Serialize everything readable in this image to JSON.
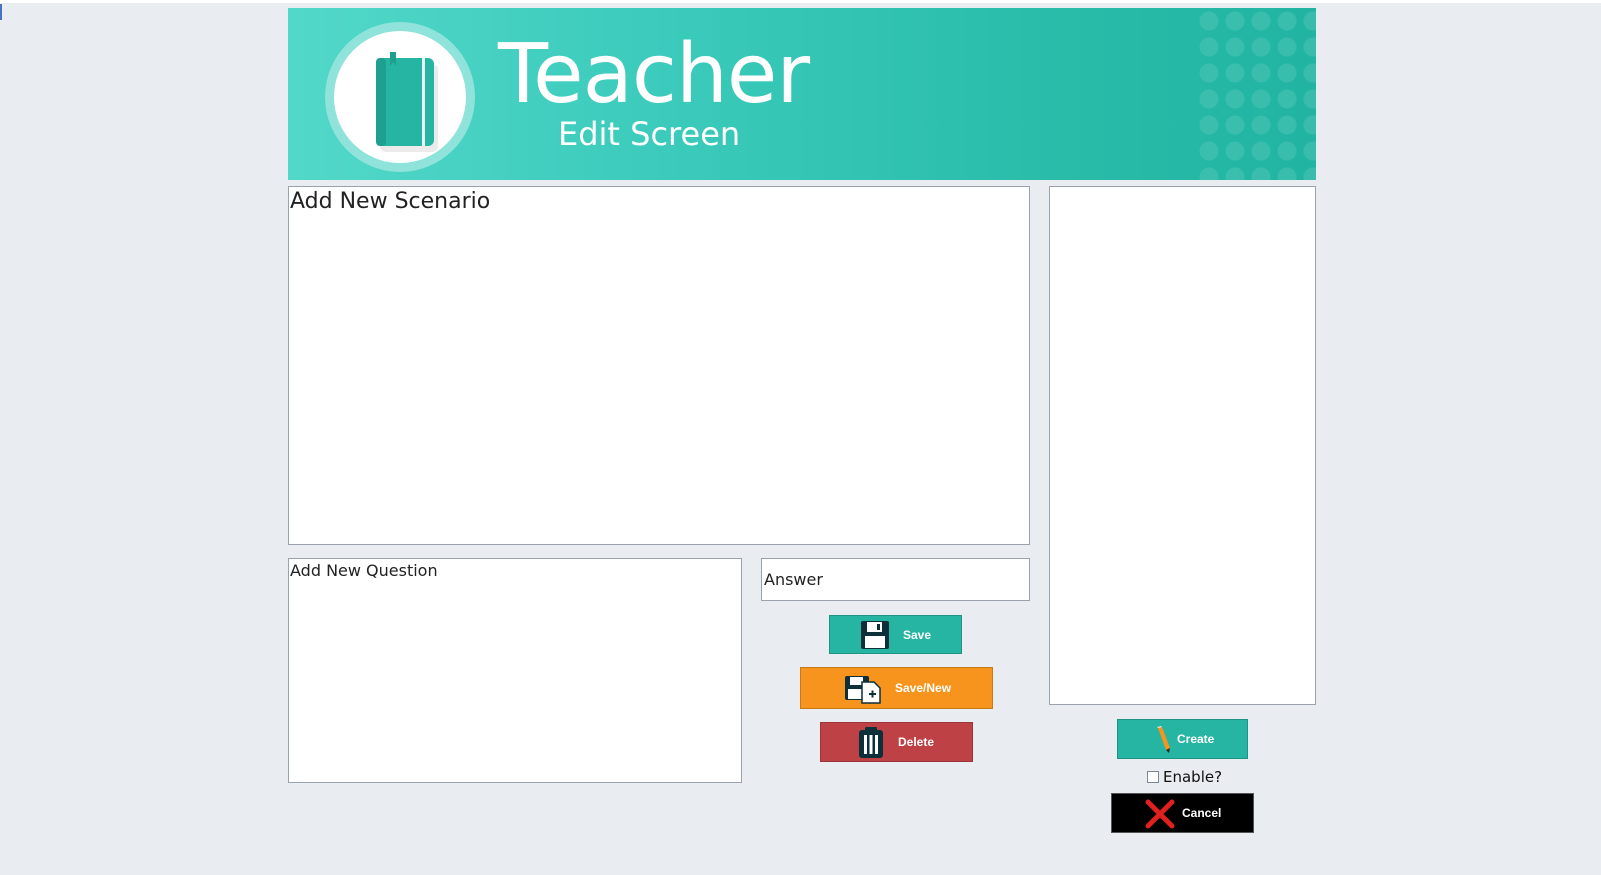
{
  "header": {
    "title": "Teacher",
    "subtitle": "Edit Screen",
    "logo_icon": "book-icon"
  },
  "scenario": {
    "value": "Add New Scenario"
  },
  "question": {
    "value": "Add New Question"
  },
  "answer": {
    "value": "Answer"
  },
  "buttons": {
    "save_label": "Save",
    "save_new_label": "Save/New",
    "delete_label": "Delete",
    "create_label": "Create",
    "cancel_label": "Cancel"
  },
  "enable": {
    "label": "Enable?",
    "checked": false
  },
  "colors": {
    "brand_teal": "#26b5a3",
    "save_new_orange": "#f7941d",
    "delete_red": "#be4146",
    "cancel_black": "#000000",
    "background": "#e9ecf1"
  }
}
